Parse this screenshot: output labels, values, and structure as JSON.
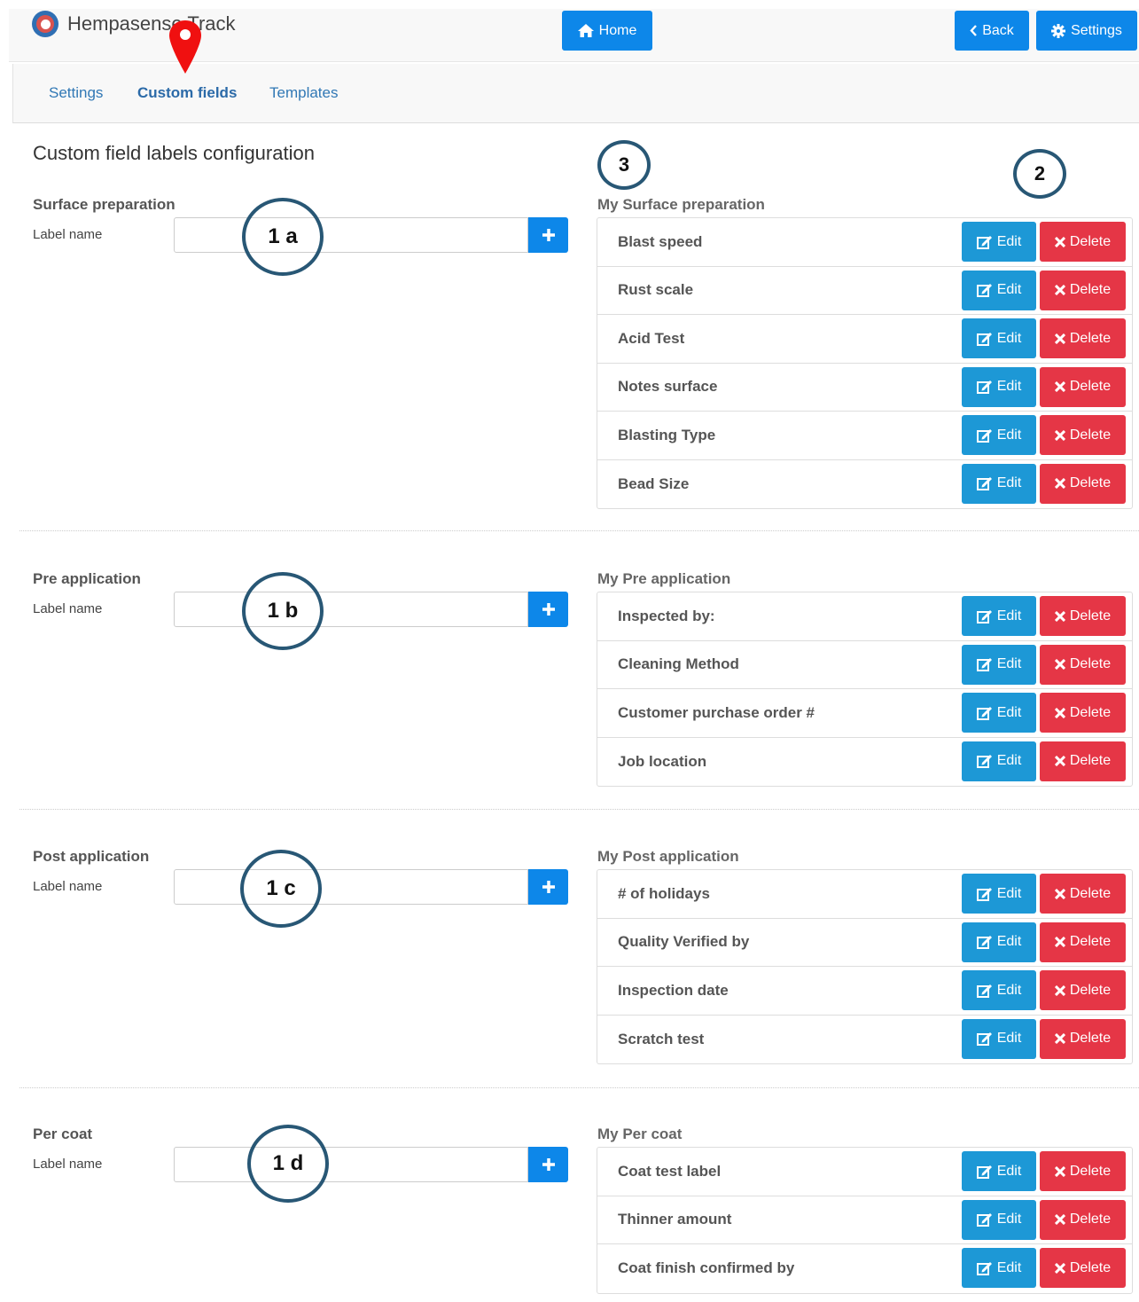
{
  "app": {
    "name": "Hempasense Track"
  },
  "topbar": {
    "home_label": "Home",
    "back_label": "Back",
    "settings_label": "Settings"
  },
  "subnav": [
    {
      "label": "Settings",
      "active": false
    },
    {
      "label": "Custom fields",
      "active": true
    },
    {
      "label": "Templates",
      "active": false
    }
  ],
  "page_title": "Custom field labels configuration",
  "label_name": "Label name",
  "buttons": {
    "edit": "Edit",
    "delete": "Delete"
  },
  "callouts": {
    "list": "3",
    "actions": "2"
  },
  "sections": [
    {
      "title": "Surface preparation",
      "callout": "1 a",
      "list_title": "My Surface preparation",
      "items": [
        "Blast speed",
        "Rust scale",
        "Acid Test",
        "Notes surface",
        "Blasting Type",
        "Bead Size"
      ]
    },
    {
      "title": "Pre application",
      "callout": "1 b",
      "list_title": "My Pre application",
      "items": [
        "Inspected by:",
        "Cleaning Method",
        "Customer purchase order #",
        "Job location"
      ]
    },
    {
      "title": "Post application",
      "callout": "1 c",
      "list_title": "My Post application",
      "items": [
        "# of holidays",
        "Quality Verified by",
        "Inspection date",
        "Scratch test"
      ]
    },
    {
      "title": "Per coat",
      "callout": "1 d",
      "list_title": "My Per coat",
      "items": [
        "Coat test label",
        "Thinner amount",
        "Coat finish confirmed by"
      ]
    }
  ]
}
